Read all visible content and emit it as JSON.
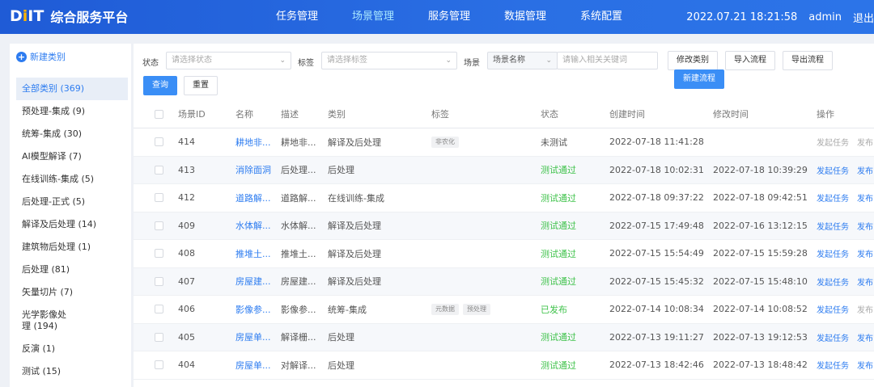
{
  "header": {
    "logo_prefix": "D",
    "logo_dot": "i",
    "logo_suffix": "IT",
    "title": "综合服务平台",
    "nav": [
      "任务管理",
      "场景管理",
      "服务管理",
      "数据管理",
      "系统配置"
    ],
    "active_nav": "场景管理",
    "datetime": "2022.07.21 18:21:58",
    "user": "admin",
    "logout": "退出"
  },
  "sidebar": {
    "new_category": "新建类别",
    "items": [
      {
        "label": "全部类别 (369)",
        "active": true
      },
      {
        "label": "预处理-集成 (9)"
      },
      {
        "label": "统筹-集成 (30)"
      },
      {
        "label": "AI模型解译 (7)"
      },
      {
        "label": "在线训练-集成 (5)"
      },
      {
        "label": "后处理-正式 (5)"
      },
      {
        "label": "解译及后处理 (14)"
      },
      {
        "label": "建筑物后处理 (1)"
      },
      {
        "label": "后处理 (81)"
      },
      {
        "label": "矢量切片 (7)"
      },
      {
        "label": "光学影像处理 (194)",
        "line1": "光学影像处",
        "line2": "理 (194)"
      },
      {
        "label": "反演 (1)"
      },
      {
        "label": "测试 (15)"
      }
    ]
  },
  "filters": {
    "status_label": "状态",
    "status_placeholder": "请选择状态",
    "tag_label": "标签",
    "tag_placeholder": "请选择标签",
    "scene_label": "场景",
    "scene_select": "场景名称",
    "keyword_placeholder": "请输入相关关键词",
    "query": "查询",
    "reset": "重置",
    "modify_category": "修改类别",
    "import_flow": "导入流程",
    "export_flow": "导出流程",
    "new_flow": "新建流程"
  },
  "table": {
    "columns": [
      "场景ID",
      "名称",
      "描述",
      "类别",
      "标签",
      "状态",
      "创建时间",
      "修改时间",
      "操作"
    ],
    "rows": [
      {
        "id": "414",
        "name": "耕地非...",
        "desc": "耕地非...",
        "category": "解译及后处理",
        "tags": [
          "非农化"
        ],
        "status": "未测试",
        "status_type": "none",
        "created": "2022-07-18 11:41:28",
        "modified": "",
        "op1": "发起任务",
        "op2": "发布",
        "ops_disabled": true
      },
      {
        "id": "413",
        "name": "消除面洞",
        "desc": "后处理...",
        "category": "后处理",
        "tags": [],
        "status": "测试通过",
        "status_type": "pass",
        "created": "2022-07-18 10:02:31",
        "modified": "2022-07-18 10:39:29",
        "op1": "发起任务",
        "op2": "发布",
        "ops_disabled": false
      },
      {
        "id": "412",
        "name": "道路解...",
        "desc": "道路解...",
        "category": "在线训练-集成",
        "tags": [],
        "status": "测试通过",
        "status_type": "pass",
        "created": "2022-07-18 09:37:22",
        "modified": "2022-07-18 09:42:51",
        "op1": "发起任务",
        "op2": "发布",
        "ops_disabled": false
      },
      {
        "id": "409",
        "name": "水体解...",
        "desc": "水体解...",
        "category": "解译及后处理",
        "tags": [],
        "status": "测试通过",
        "status_type": "pass",
        "created": "2022-07-15 17:49:48",
        "modified": "2022-07-16 13:12:15",
        "op1": "发起任务",
        "op2": "发布",
        "ops_disabled": false
      },
      {
        "id": "408",
        "name": "推堆土...",
        "desc": "推堆土...",
        "category": "解译及后处理",
        "tags": [],
        "status": "测试通过",
        "status_type": "pass",
        "created": "2022-07-15 15:54:49",
        "modified": "2022-07-15 15:59:28",
        "op1": "发起任务",
        "op2": "发布",
        "ops_disabled": false
      },
      {
        "id": "407",
        "name": "房屋建...",
        "desc": "房屋建...",
        "category": "解译及后处理",
        "tags": [],
        "status": "测试通过",
        "status_type": "pass",
        "created": "2022-07-15 15:45:32",
        "modified": "2022-07-15 15:48:10",
        "op1": "发起任务",
        "op2": "发布",
        "ops_disabled": false
      },
      {
        "id": "406",
        "name": "影像参...",
        "desc": "影像参...",
        "category": "统筹-集成",
        "tags": [
          "元数据",
          "预处理"
        ],
        "status": "已发布",
        "status_type": "pub",
        "created": "2022-07-14 10:08:34",
        "modified": "2022-07-14 10:08:52",
        "op1": "发起任务",
        "op2": "发布",
        "ops_disabled": false,
        "op2_disabled": true
      },
      {
        "id": "405",
        "name": "房屋单...",
        "desc": "解译栅...",
        "category": "后处理",
        "tags": [],
        "status": "测试通过",
        "status_type": "pass",
        "created": "2022-07-13 19:11:27",
        "modified": "2022-07-13 19:12:53",
        "op1": "发起任务",
        "op2": "发布",
        "ops_disabled": false
      },
      {
        "id": "404",
        "name": "房屋单...",
        "desc": "对解译...",
        "category": "后处理",
        "tags": [],
        "status": "测试通过",
        "status_type": "pass",
        "created": "2022-07-13 18:42:46",
        "modified": "2022-07-13 18:48:42",
        "op1": "发起任务",
        "op2": "发布",
        "ops_disabled": false
      }
    ]
  }
}
